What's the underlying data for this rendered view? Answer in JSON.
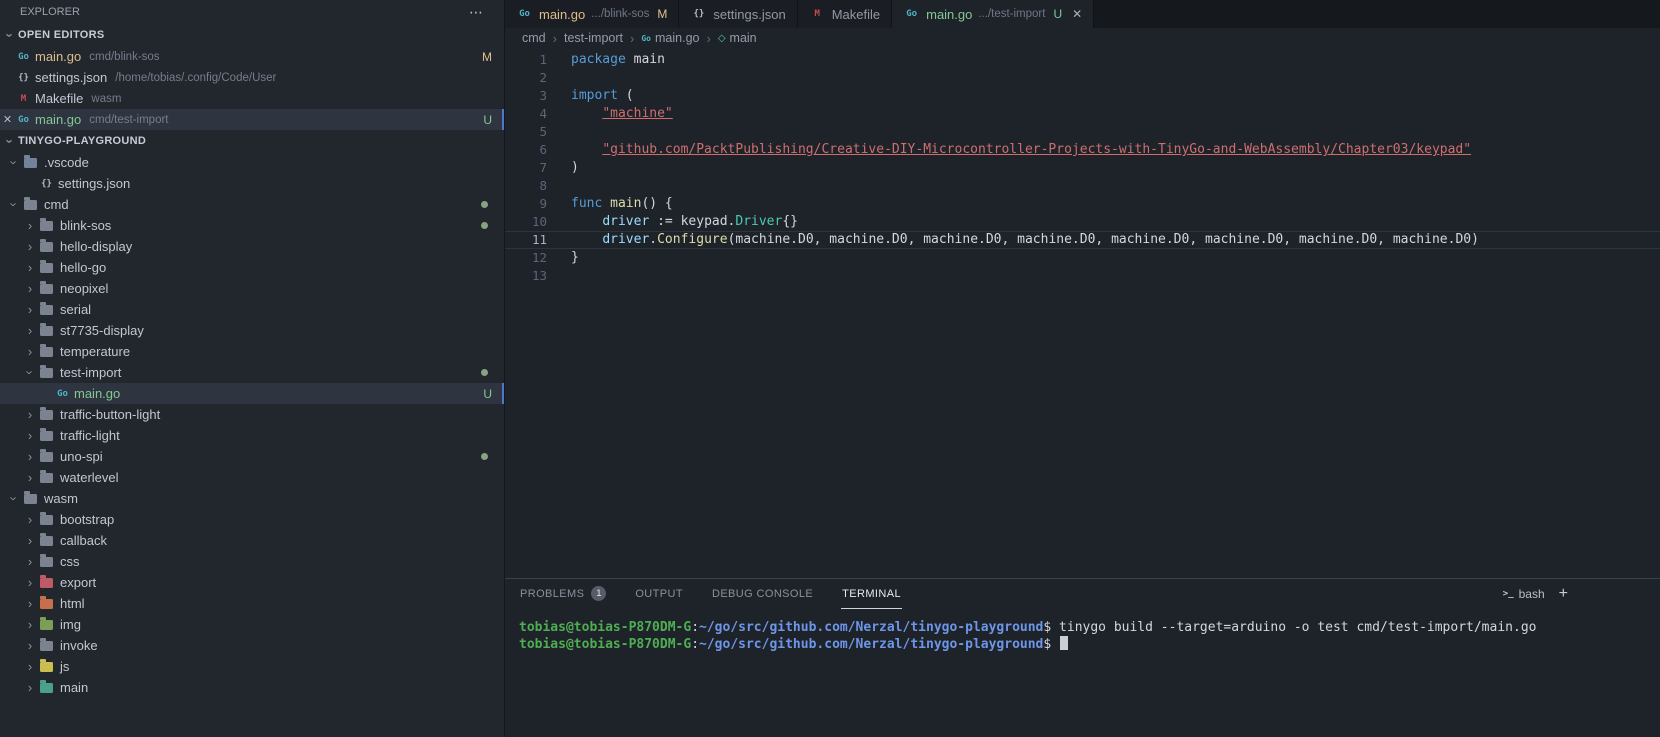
{
  "colors": {
    "accent_blue": "#4d78cc",
    "git_modified": "#e2c08d",
    "git_untracked": "#81c995",
    "selection_bg": "#2e3540"
  },
  "icons": {
    "folder": {
      "color": "#7b8290"
    },
    "go": {
      "glyph": "Go",
      "color": "#4fb3c5"
    },
    "json": {
      "glyph": "{}",
      "color": "#b4bbc7"
    },
    "makefile": {
      "glyph": "M",
      "color": "#cc4a50"
    },
    "package": {
      "glyph": "◇",
      "color": "#4ec9b0"
    }
  },
  "explorer": {
    "title": "EXPLORER",
    "more_label": "⋯",
    "open_editors": {
      "label": "OPEN EDITORS",
      "items": [
        {
          "icon": "go",
          "name": "main.go",
          "name_class": "mod",
          "desc": "cmd/blink-sos",
          "badge": "M",
          "badge_class": "mod"
        },
        {
          "icon": "json",
          "name": "settings.json",
          "desc": "/home/tobias/.config/Code/User"
        },
        {
          "icon": "makefile",
          "name": "Makefile",
          "desc": "wasm"
        },
        {
          "icon": "go",
          "name": "main.go",
          "name_class": "untracked",
          "desc": "cmd/test-import",
          "badge": "U",
          "badge_class": "untracked",
          "selected": true,
          "close": "✕"
        }
      ]
    },
    "workspace": {
      "label": "TINYGO-PLAYGROUND",
      "tree": [
        {
          "label": ".vscode",
          "kind": "folder",
          "level": 1,
          "expanded": true,
          "color": "#74839c"
        },
        {
          "label": "settings.json",
          "kind": "json",
          "level": 2
        },
        {
          "label": "cmd",
          "kind": "folder",
          "level": 1,
          "expanded": true,
          "dot": true
        },
        {
          "label": "blink-sos",
          "kind": "folder",
          "level": 2,
          "dot": true
        },
        {
          "label": "hello-display",
          "kind": "folder",
          "level": 2
        },
        {
          "label": "hello-go",
          "kind": "folder",
          "level": 2
        },
        {
          "label": "neopixel",
          "kind": "folder",
          "level": 2
        },
        {
          "label": "serial",
          "kind": "folder",
          "level": 2
        },
        {
          "label": "st7735-display",
          "kind": "folder",
          "level": 2
        },
        {
          "label": "temperature",
          "kind": "folder",
          "level": 2
        },
        {
          "label": "test-import",
          "kind": "folder",
          "level": 2,
          "expanded": true,
          "dot": true
        },
        {
          "label": "main.go",
          "kind": "go",
          "level": 3,
          "selected": true,
          "badge": "U",
          "badge_class": "untracked",
          "label_class": "untracked"
        },
        {
          "label": "traffic-button-light",
          "kind": "folder",
          "level": 2
        },
        {
          "label": "traffic-light",
          "kind": "folder",
          "level": 2
        },
        {
          "label": "uno-spi",
          "kind": "folder",
          "level": 2,
          "dot": true
        },
        {
          "label": "waterlevel",
          "kind": "folder",
          "level": 2
        },
        {
          "label": "wasm",
          "kind": "folder",
          "level": 1,
          "expanded": true
        },
        {
          "label": "bootstrap",
          "kind": "folder",
          "level": 2
        },
        {
          "label": "callback",
          "kind": "folder",
          "level": 2
        },
        {
          "label": "css",
          "kind": "folder",
          "level": 2
        },
        {
          "label": "export",
          "kind": "folder",
          "level": 2,
          "color": "#bf5b66"
        },
        {
          "label": "html",
          "kind": "folder",
          "level": 2,
          "color": "#c66f4c"
        },
        {
          "label": "img",
          "kind": "folder",
          "level": 2,
          "color": "#7c9e56"
        },
        {
          "label": "invoke",
          "kind": "folder",
          "level": 2
        },
        {
          "label": "js",
          "kind": "folder",
          "level": 2,
          "color": "#ccbd51"
        },
        {
          "label": "main",
          "kind": "folder",
          "level": 2,
          "color": "#49a18b"
        }
      ]
    }
  },
  "tabs": [
    {
      "icon": "go",
      "label": "main.go",
      "label_class": "mod",
      "desc": ".../blink-sos",
      "badge": "M",
      "badge_class": "mod"
    },
    {
      "icon": "json",
      "label": "settings.json"
    },
    {
      "icon": "makefile",
      "label": "Makefile"
    },
    {
      "icon": "go",
      "label": "main.go",
      "label_class": "untracked",
      "desc": ".../test-import",
      "badge": "U",
      "badge_class": "untracked",
      "active": true,
      "close": "✕"
    }
  ],
  "breadcrumb": [
    {
      "label": "cmd"
    },
    {
      "label": "test-import"
    },
    {
      "label": "main.go",
      "icon": "go"
    },
    {
      "label": "main",
      "icon": "package"
    }
  ],
  "editor": {
    "lines": [
      {
        "n": 1,
        "tokens": [
          [
            "package",
            "kw"
          ],
          [
            " main",
            "pl"
          ]
        ]
      },
      {
        "n": 2,
        "tokens": []
      },
      {
        "n": 3,
        "tokens": [
          [
            "import",
            "kw"
          ],
          [
            " (",
            "pl"
          ]
        ]
      },
      {
        "n": 4,
        "tokens": [
          [
            "    ",
            "pl"
          ],
          [
            "\"machine\"",
            "str lnk"
          ]
        ]
      },
      {
        "n": 5,
        "tokens": []
      },
      {
        "n": 6,
        "tokens": [
          [
            "    ",
            "pl"
          ],
          [
            "\"github.com/PacktPublishing/Creative-DIY-Microcontroller-Projects-with-TinyGo-and-WebAssembly/Chapter03/keypad\"",
            "str lnk"
          ]
        ]
      },
      {
        "n": 7,
        "tokens": [
          [
            ")",
            "pl"
          ]
        ]
      },
      {
        "n": 8,
        "tokens": []
      },
      {
        "n": 9,
        "tokens": [
          [
            "func",
            "kw"
          ],
          [
            " ",
            "pl"
          ],
          [
            "main",
            "fn"
          ],
          [
            "() {",
            "pl"
          ]
        ]
      },
      {
        "n": 10,
        "tokens": [
          [
            "    ",
            "pl"
          ],
          [
            "driver",
            "vr"
          ],
          [
            " := keypad.",
            "pl"
          ],
          [
            "Driver",
            "ty"
          ],
          [
            "{}",
            "pl"
          ]
        ]
      },
      {
        "n": 11,
        "active": true,
        "tokens": [
          [
            "    ",
            "pl"
          ],
          [
            "driver",
            "vr"
          ],
          [
            ".",
            "pl"
          ],
          [
            "Configure",
            "fn"
          ],
          [
            "(machine.D0, machine.D0, machine.D0, machine.D0, machine.D0, machine.D0, machine.D0, machine.D0)",
            "pl"
          ]
        ]
      },
      {
        "n": 12,
        "tokens": [
          [
            "}",
            "pl"
          ]
        ]
      },
      {
        "n": 13,
        "tokens": []
      }
    ]
  },
  "panel": {
    "tabs": [
      {
        "label": "PROBLEMS",
        "badge": "1"
      },
      {
        "label": "OUTPUT"
      },
      {
        "label": "DEBUG CONSOLE"
      },
      {
        "label": "TERMINAL",
        "active": true
      }
    ],
    "shell_label": "bash",
    "new_terminal_label": "+"
  },
  "terminal": {
    "lines": [
      {
        "tokens": [
          [
            "tobias@tobias-P870DM-G",
            "tg"
          ],
          [
            ":",
            "tp"
          ],
          [
            "~/go/src/github.com/Nerzal/tinygo-playground",
            "tb"
          ],
          [
            "$",
            "tp"
          ],
          [
            " tinygo build --target=arduino -o test cmd/test-import/main.go",
            "tp"
          ]
        ]
      },
      {
        "cursor": true,
        "tokens": [
          [
            "tobias@tobias-P870DM-G",
            "tg"
          ],
          [
            ":",
            "tp"
          ],
          [
            "~/go/src/github.com/Nerzal/tinygo-playground",
            "tb"
          ],
          [
            "$",
            "tp"
          ],
          [
            " ",
            "tp"
          ]
        ]
      }
    ]
  }
}
